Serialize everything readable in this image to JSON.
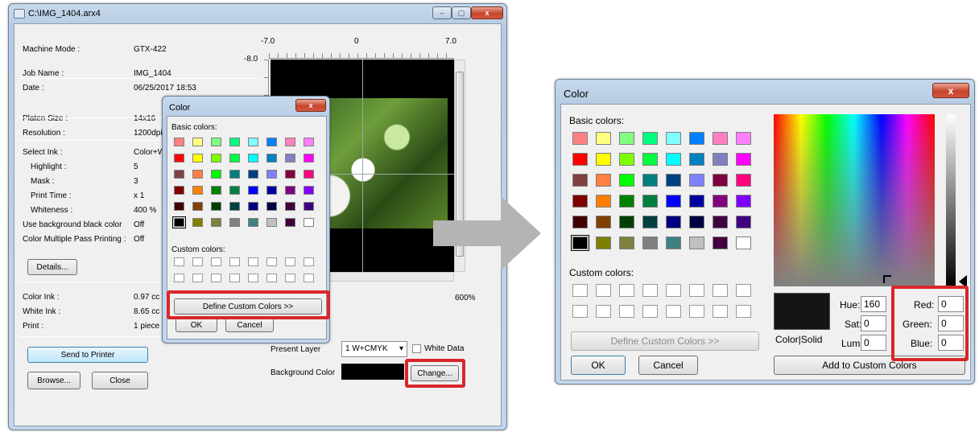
{
  "main_window": {
    "title": "C:\\IMG_1404.arx4",
    "info": [
      {
        "label": "Machine Mode :",
        "value": "GTX-422"
      },
      {
        "label": "Job Name :",
        "value": "IMG_1404"
      },
      {
        "label": "Date :",
        "value": "06/25/2017 18:53"
      },
      {
        "label": "Platen Size :",
        "value": "14x16"
      },
      {
        "label": "Resolution :",
        "value": "1200dpi"
      },
      {
        "label": "Select Ink :",
        "value": "Color+W"
      },
      {
        "label": "Highlight :",
        "value": "5"
      },
      {
        "label": "Mask :",
        "value": "3"
      },
      {
        "label": "Print Time :",
        "value": "x 1"
      },
      {
        "label": "Whiteness :",
        "value": "400 %"
      },
      {
        "label": "Use background black color",
        "value": "Off"
      },
      {
        "label": "Color Multiple Pass Printing :",
        "value": "Off"
      }
    ],
    "details_button": "Details...",
    "ink": [
      {
        "label": "Color Ink :",
        "value": "0.97 cc"
      },
      {
        "label": "White Ink :",
        "value": "8.65 cc"
      },
      {
        "label": "Print :",
        "value": "1 piece"
      }
    ],
    "send_button": "Send to Printer",
    "browse_button": "Browse...",
    "close_button": "Close",
    "ruler": {
      "left": "-7.0",
      "center": "0",
      "right": "7.0",
      "v_top": "-8.0"
    },
    "zoom": "600%",
    "present_layer_label": "Present Layer",
    "present_layer_value": "1 W+CMYK",
    "white_data_label": "White Data",
    "background_color_label": "Background Color",
    "change_button": "Change..."
  },
  "small_color_dialog": {
    "title": "Color",
    "basic_label": "Basic colors:",
    "custom_label": "Custom colors:",
    "define_button": "Define Custom Colors >>",
    "ok_button": "OK",
    "cancel_button": "Cancel"
  },
  "large_color_dialog": {
    "title": "Color",
    "basic_label": "Basic colors:",
    "custom_label": "Custom colors:",
    "define_button": "Define Custom Colors >>",
    "ok_button": "OK",
    "cancel_button": "Cancel",
    "color_solid_label": "Color|Solid",
    "hue_label": "Hue:",
    "hue_value": "160",
    "sat_label": "Sat:",
    "sat_value": "0",
    "lum_label": "Lum:",
    "lum_value": "0",
    "red_label": "Red:",
    "red_value": "0",
    "green_label": "Green:",
    "green_value": "0",
    "blue_label": "Blue:",
    "blue_value": "0",
    "add_button": "Add to Custom Colors"
  },
  "basic_colors": [
    "#ff8080",
    "#ffff80",
    "#80ff80",
    "#00ff80",
    "#80ffff",
    "#0080ff",
    "#ff80c0",
    "#ff80ff",
    "#ff0000",
    "#ffff00",
    "#80ff00",
    "#00ff40",
    "#00ffff",
    "#0080c0",
    "#8080c0",
    "#ff00ff",
    "#804040",
    "#ff8040",
    "#00ff00",
    "#008080",
    "#004080",
    "#8080ff",
    "#800040",
    "#ff0080",
    "#800000",
    "#ff8000",
    "#008000",
    "#008040",
    "#0000ff",
    "#0000a0",
    "#800080",
    "#8000ff",
    "#400000",
    "#804000",
    "#004000",
    "#004040",
    "#000080",
    "#000040",
    "#400040",
    "#400080",
    "#000000",
    "#808000",
    "#808040",
    "#808080",
    "#408080",
    "#c0c0c0",
    "#400040",
    "#ffffff"
  ],
  "close_glyph": "x",
  "min_glyph": "–",
  "max_glyph": "▢"
}
